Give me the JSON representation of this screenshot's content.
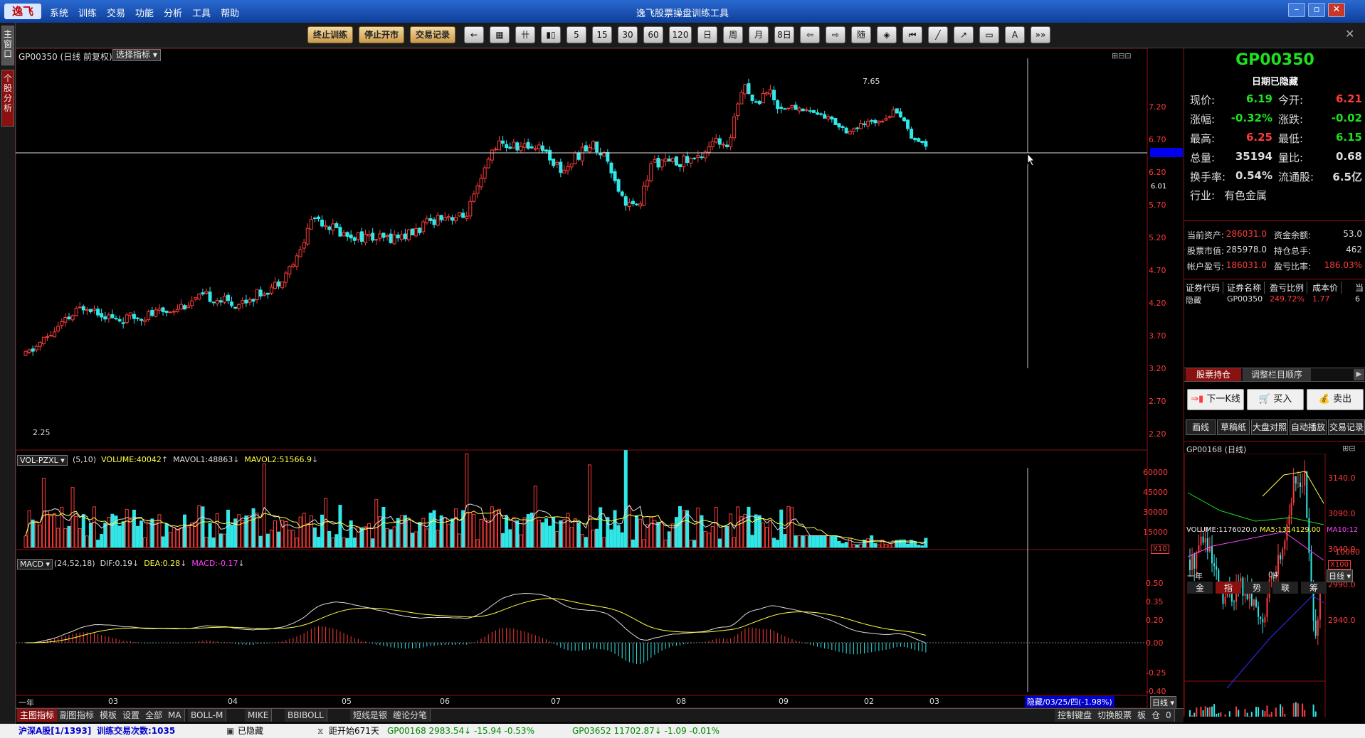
{
  "app": {
    "logo": "逸飞",
    "title": "逸飞股票操盘训练工具",
    "menu": [
      "系统",
      "训练",
      "交易",
      "功能",
      "分析",
      "工具",
      "帮助"
    ]
  },
  "toolbar": {
    "buttons": [
      "终止训练",
      "停止开市",
      "交易记录"
    ],
    "icons": [
      "←",
      "▦",
      "卄",
      "▮▯",
      "5",
      "15",
      "30",
      "60",
      "120",
      "日",
      "周",
      "月",
      "8日",
      "⇦",
      "⇨",
      "随",
      "◈",
      "⏮",
      "╱",
      "↗",
      "▭",
      "A",
      "»»"
    ]
  },
  "left_tabs": [
    "主窗口",
    "个股分析"
  ],
  "main_chart": {
    "header": "GP00350 (日线 前复权)",
    "selector": "选择指标",
    "y_ticks": [
      "7.20",
      "6.70",
      "6.20",
      "5.70",
      "5.20",
      "4.70",
      "4.20",
      "3.70",
      "3.20",
      "2.70",
      "2.20"
    ],
    "high_label": "7.65",
    "low_label": "2.25",
    "crosshair_price": "6.01"
  },
  "volume_panel": {
    "indicator": "VOL-PZXL",
    "params": "(5,10)",
    "volume": "VOLUME:40042",
    "mavol1": "MAVOL1:48863",
    "mavol2": "MAVOL2:51566.9",
    "y_ticks": [
      "60000",
      "45000",
      "30000",
      "15000"
    ],
    "unit": "X10"
  },
  "macd_panel": {
    "indicator": "MACD",
    "params": "(24,52,18)",
    "dif": "DIF:0.19",
    "dea": "DEA:0.28",
    "macd": "MACD:-0.17",
    "y_ticks": [
      "0.50",
      "0.35",
      "0.20",
      "0.00",
      "-0.25",
      "-0.40"
    ]
  },
  "x_axis": {
    "labels": [
      "一年",
      "03",
      "04",
      "05",
      "06",
      "07",
      "08",
      "09",
      "02",
      "03"
    ],
    "hidden_date": "隐藏/03/25/四(-1.98%)",
    "period": "日线"
  },
  "bottom_tabs": [
    "主图指标",
    "副图指标",
    "模板",
    "设置",
    "全部",
    "MA",
    "BOLL-M",
    "MIKE",
    "BBIBOLL",
    "短线是银",
    "缠论分笔"
  ],
  "bottom_right": [
    "控制键盘",
    "切换股票",
    "板",
    "仓",
    "0"
  ],
  "quote": {
    "code": "GP00350",
    "date": "日期已隐藏",
    "rows": [
      [
        "现价:",
        "6.19",
        "今开:",
        "6.21"
      ],
      [
        "涨幅:",
        "-0.32%",
        "涨跌:",
        "-0.02"
      ],
      [
        "最高:",
        "6.25",
        "最低:",
        "6.15"
      ],
      [
        "总量:",
        "35194",
        "量比:",
        "0.68"
      ],
      [
        "换手率:",
        "0.54%",
        "流通股:",
        "6.5亿"
      ]
    ],
    "industry_label": "行业:",
    "industry": "有色金属"
  },
  "account": {
    "rows": [
      [
        "当前资产:",
        "286031.0",
        "资金余额:",
        "53.0"
      ],
      [
        "股票市值:",
        "285978.0",
        "持仓总手:",
        "462"
      ],
      [
        "帐户盈亏:",
        "186031.0",
        "盈亏比率:",
        "186.03%"
      ]
    ]
  },
  "holdings": {
    "headers": [
      "证券代码",
      "证券名称",
      "盈亏比例",
      "成本价",
      "当"
    ],
    "row": [
      "隐藏",
      "GP00350",
      "249.72%",
      "1.77",
      "6"
    ]
  },
  "tabs": [
    "股票持仓",
    "调整栏目顺序"
  ],
  "actions": [
    "下一K线",
    "买入",
    "卖出"
  ],
  "small_buttons": [
    "画线",
    "草稿纸",
    "大盘对照",
    "自动播放",
    "交易记录"
  ],
  "mini_chart": {
    "title": "GP00168 (日线)",
    "y_ticks": [
      "3140.0",
      "3090.0",
      "3040.0",
      "2990.0",
      "2940.0"
    ],
    "volume": "VOLUME:1176020.0",
    "ma5": "MA5:1314129.00",
    "ma10": "MA10:12",
    "vol_tick": "10000",
    "unit": "X100",
    "x_labels": [
      "一年",
      "04"
    ],
    "period": "日线",
    "tabs": [
      "金",
      "指",
      "势",
      "联",
      "筹"
    ]
  },
  "status": [
    "沪深A股[1/1393]",
    "训练交易次数:1035",
    "已隐藏",
    "距开始671天",
    "GP00168 2983.54↓ -15.94 -0.53%",
    "GP03652 11702.87↓ -1.09 -0.01%"
  ],
  "colors": {
    "up": "#ff3b3b",
    "down": "#31e6e6",
    "ma_yellow": "#ffff44",
    "panel_border": "#8b1010"
  }
}
